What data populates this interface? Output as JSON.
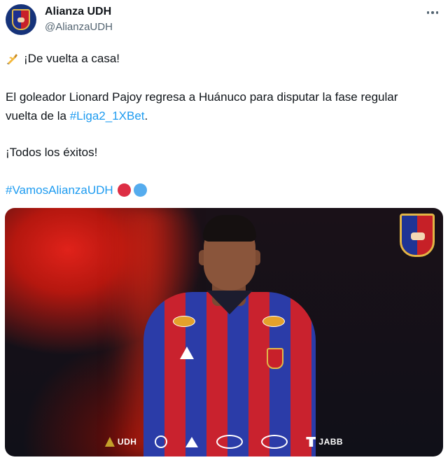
{
  "author": {
    "name": "Alianza UDH",
    "handle": "@AlianzaUDH"
  },
  "tweet": {
    "line1": "¡De vuelta a casa!",
    "line2": "El goleador Lionard Pajoy regresa a Huánuco para disputar la fase regular",
    "line3_prefix": "vuelta de la ",
    "line3_hashtag": "#Liga2_1XBet",
    "line3_suffix": ".",
    "line4": "¡Todos los éxitos!",
    "hashtag": "#VamosAlianzaUDH"
  },
  "icons": {
    "pen": "writing-hand-icon",
    "more": "more-options-icon",
    "red_circle": "red-circle-emoji",
    "blue_circle": "blue-circle-emoji"
  },
  "media": {
    "sponsors": [
      "UDH",
      "JABB"
    ]
  },
  "colors": {
    "hashtag": "#1d9bf0",
    "red_circle": "#dd2e44",
    "blue_circle": "#55acee",
    "handle": "#536471"
  }
}
